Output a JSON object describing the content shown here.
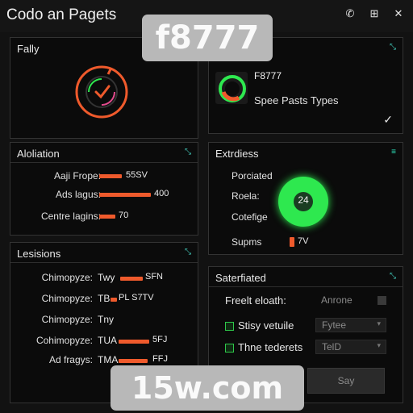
{
  "app": {
    "title": "Codo an Pagets"
  },
  "window_controls": [
    "phone-icon",
    "grid-icon",
    "close-icon"
  ],
  "watermark_top": "f8777",
  "watermark_bottom": "15w.com",
  "panel_fally": {
    "title": "Fally"
  },
  "panel_f8777": {
    "name": "F8777",
    "subtitle": "Spee Pasts Types",
    "check": "✓"
  },
  "panel_aloliation": {
    "title": "Aloliation",
    "rows": [
      {
        "label": "Aaji Frope:",
        "value": "55SV",
        "level": 0.38
      },
      {
        "label": "Ads lagus:",
        "value": "400",
        "level": 0.88
      },
      {
        "label": "Centre lagins:",
        "value": "70",
        "level": 0.28
      }
    ]
  },
  "panel_extrdiess": {
    "title": "Extrdiess",
    "labels": [
      "Porciated",
      "Roela:",
      "Cotefige",
      "Supms"
    ],
    "dial_value": "24",
    "supms_value": "7V"
  },
  "panel_lesisions": {
    "title": "Lesisions",
    "rows": [
      {
        "label": "Chimopyze:",
        "mid": "Twy",
        "value": "SFN",
        "level": 0.5
      },
      {
        "label": "Chimopyze:",
        "mid": "TB",
        "value": "PL S7TV",
        "level": 0.2
      },
      {
        "label": "Chimopyze:",
        "mid": "Tny",
        "value": "",
        "level": 0
      },
      {
        "label": "Cohimopyze:",
        "mid": "TUA",
        "value": "5FJ",
        "level": 0.7
      },
      {
        "label": "Ad fragys:",
        "mid": "TMA",
        "value": "FFJ",
        "level": 0.65
      }
    ]
  },
  "panel_saterfiated": {
    "title": "Saterfiated",
    "row1": {
      "label": "Freelt eloath:",
      "value": "Anrone"
    },
    "row2": {
      "label": "Stisy vetuile",
      "value": "Fytee"
    },
    "row3": {
      "label": "Thne tederets",
      "value": "TelD"
    },
    "button": "Say"
  },
  "colors": {
    "accent_orange": "#ef5a2c",
    "accent_green": "#2ee84f",
    "accent_teal": "#46d7c6"
  }
}
